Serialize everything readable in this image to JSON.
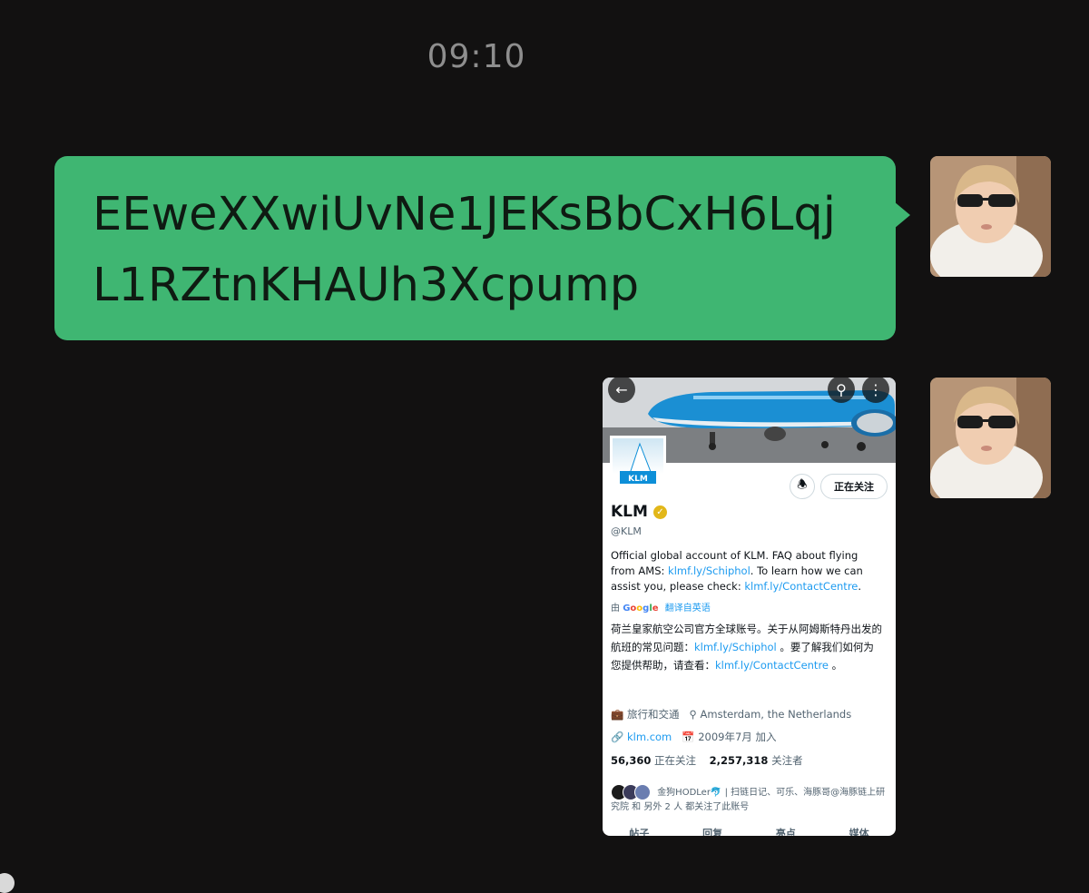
{
  "chat": {
    "timestamp": "09:10",
    "message_text": "EEweXXwiUvNe1JEKsBbCxH6LqjL1RZtnKHAUh3Xcpump"
  },
  "screenshot": {
    "profile_name": "KLM",
    "handle": "@KLM",
    "follow_button": "正在关注",
    "bio_prefix": "Official global account of KLM. FAQ about flying from AMS: ",
    "bio_link1": "klmf.ly/Schiphol",
    "bio_middle": ". To learn how we can assist you, please check: ",
    "bio_link2": "klmf.ly/ContactCentre",
    "bio_suffix": ".",
    "translate_by": "由",
    "translate_label": "翻译自英语",
    "cn_line1": "荷兰皇家航空公司官方全球账号。关于从阿姆斯特丹出发的航班的常见问题：",
    "cn_link1": "klmf.ly/Schiphol",
    "cn_line2": " 。要了解我们如何为您提供帮助，请查看：",
    "cn_link2": "klmf.ly/ContactCentre",
    "cn_end": " 。",
    "category": "旅行和交通",
    "location": "Amsterdam, the Netherlands",
    "website": "klm.com",
    "joined": "2009年7月 加入",
    "following_count": "56,360",
    "following_label": "正在关注",
    "followers_count": "2,257,318",
    "followers_label": "关注者",
    "followed_by_text": "金狗HODLer🐬 | 扫链日记、可乐、海豚哥@海豚链上研究院 和 另外 2 人 都关注了此账号",
    "tabs": [
      "帖子",
      "回复",
      "亮点",
      "媒体"
    ]
  },
  "colors": {
    "background": "#121111",
    "bubble": "#3fb672",
    "link": "#1d9bf0",
    "verified": "#e2b719"
  }
}
